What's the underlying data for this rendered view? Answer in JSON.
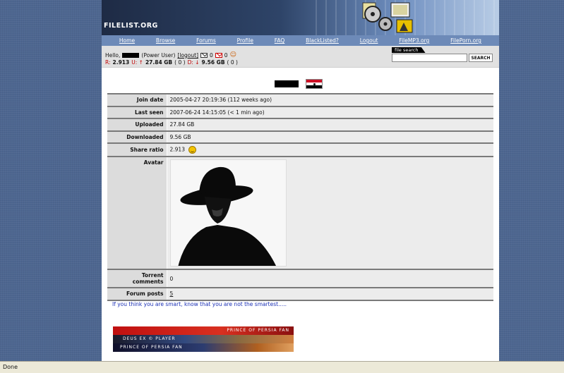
{
  "site": {
    "logo": "FILELIST.ORG"
  },
  "nav": {
    "items": [
      "Home",
      "Browse",
      "Forums",
      "Profile",
      "FAQ",
      "BlackListed?",
      "Logout",
      "FileMP3.org",
      "FilePorn.org"
    ]
  },
  "userbar": {
    "hello": "Hello,",
    "user_class": "(Power User)",
    "logout": "[logout]",
    "inbox_count": "0",
    "outbox_count": "0",
    "ratio_label": "R:",
    "ratio_value": "2.913",
    "up_label": "U: ↑",
    "up_value": "27.84 GB",
    "up_extra": "( 0 )",
    "down_label": "D: ↓",
    "down_value": "9.56 GB",
    "down_extra": "( 0 )"
  },
  "search": {
    "tab_label": "file search",
    "button": "SEARCH",
    "placeholder": ""
  },
  "profile": {
    "rows": [
      {
        "label": "Join date",
        "value": "2005-04-27 20:19:36 (112 weeks ago)"
      },
      {
        "label": "Last seen",
        "value": "2007-06-24 14:15:05 (< 1 min ago)"
      },
      {
        "label": "Uploaded",
        "value": "27.84 GB"
      },
      {
        "label": "Downloaded",
        "value": "9.56 GB"
      },
      {
        "label": "Share ratio",
        "value": "2.913"
      }
    ],
    "avatar_label": "Avatar",
    "torrent_comments_label": "Torrent comments",
    "torrent_comments_value": "0",
    "forum_posts_label": "Forum posts",
    "forum_posts_value": "5"
  },
  "signature": {
    "text": "If you think you are smart, know that you are not the smartest.....",
    "banners": [
      "PRINCE OF PERSIA FAN",
      "DEUS EX © PLAYER",
      "PRINCE OF PERSIA FAN"
    ]
  },
  "statusbar": {
    "text": "Done"
  }
}
